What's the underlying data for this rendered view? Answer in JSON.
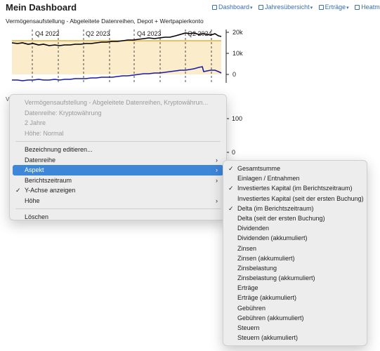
{
  "header": {
    "title": "Mein Dashboard",
    "links": [
      {
        "label": "Dashboard",
        "icon": "dashboard-icon",
        "caret": true
      },
      {
        "label": "Jahresübersicht",
        "icon": "calendar-icon",
        "caret": true
      },
      {
        "label": "Erträge",
        "icon": "income-icon",
        "caret": true
      },
      {
        "label": "Heatmaps",
        "icon": "heatmap-icon",
        "caret": false
      }
    ]
  },
  "chart": {
    "title": "Vermögensaufstellung - Abgeleitete Datenreihen, Depot + Wertpapierkonto",
    "x_labels": [
      "Q4 2022",
      "Q2 2023",
      "Q4 2023",
      "Q2 2024"
    ],
    "y_labels": [
      "20k",
      "10k",
      "0"
    ]
  },
  "chart_data": {
    "type": "line",
    "x": [
      "Q4 2022",
      "Q2 2023",
      "Q4 2023",
      "Q2 2024"
    ],
    "series": [],
    "yticks": [
      "20k",
      "10k",
      "0"
    ]
  },
  "chart2": {
    "hint": "Ver",
    "y_labels": [
      "100",
      "0"
    ]
  },
  "menu": {
    "disabled_items": [
      "Vermögensaufstellung - Abgeleitete Datenreihen, Kryptowährun...",
      "Datenreihe: Kryptowährung",
      "2 Jahre",
      "Höhe: Normal"
    ],
    "items": [
      {
        "label": "Bezeichnung editieren...",
        "submenu": false,
        "checked": false
      },
      {
        "label": "Datenreihe",
        "submenu": true,
        "checked": false
      },
      {
        "label": "Aspekt",
        "submenu": true,
        "checked": false,
        "highlighted": true
      },
      {
        "label": "Berichtszeitraum",
        "submenu": true,
        "checked": false
      },
      {
        "label": "Y-Achse anzeigen",
        "submenu": false,
        "checked": true
      },
      {
        "label": "Höhe",
        "submenu": true,
        "checked": false
      }
    ],
    "delete_label": "Löschen"
  },
  "submenu": {
    "items": [
      {
        "label": "Gesamtsumme",
        "checked": true
      },
      {
        "label": "Einlagen / Entnahmen",
        "checked": false
      },
      {
        "label": "Investiertes Kapital (im Berichtszeitraum)",
        "checked": true
      },
      {
        "label": "Investiertes Kapital (seit der ersten Buchung)",
        "checked": false
      },
      {
        "label": "Delta (im Berichtszeitraum)",
        "checked": true
      },
      {
        "label": "Delta (seit der ersten Buchung)",
        "checked": false
      },
      {
        "label": "Dividenden",
        "checked": false
      },
      {
        "label": "Dividenden (akkumuliert)",
        "checked": false
      },
      {
        "label": "Zinsen",
        "checked": false
      },
      {
        "label": "Zinsen (akkumuliert)",
        "checked": false
      },
      {
        "label": "Zinsbelastung",
        "checked": false
      },
      {
        "label": "Zinsbelastung (akkumuliert)",
        "checked": false
      },
      {
        "label": "Erträge",
        "checked": false
      },
      {
        "label": "Erträge (akkumuliert)",
        "checked": false
      },
      {
        "label": "Gebühren",
        "checked": false
      },
      {
        "label": "Gebühren (akkumuliert)",
        "checked": false
      },
      {
        "label": "Steuern",
        "checked": false
      },
      {
        "label": "Steuern (akkumuliert)",
        "checked": false
      }
    ]
  },
  "colors": {
    "accent": "#3d86d8",
    "total_line": "#000000",
    "capital_line": "#e0a020",
    "capital_fill": "#fbeccb",
    "delta_line": "#1a1aa8"
  }
}
